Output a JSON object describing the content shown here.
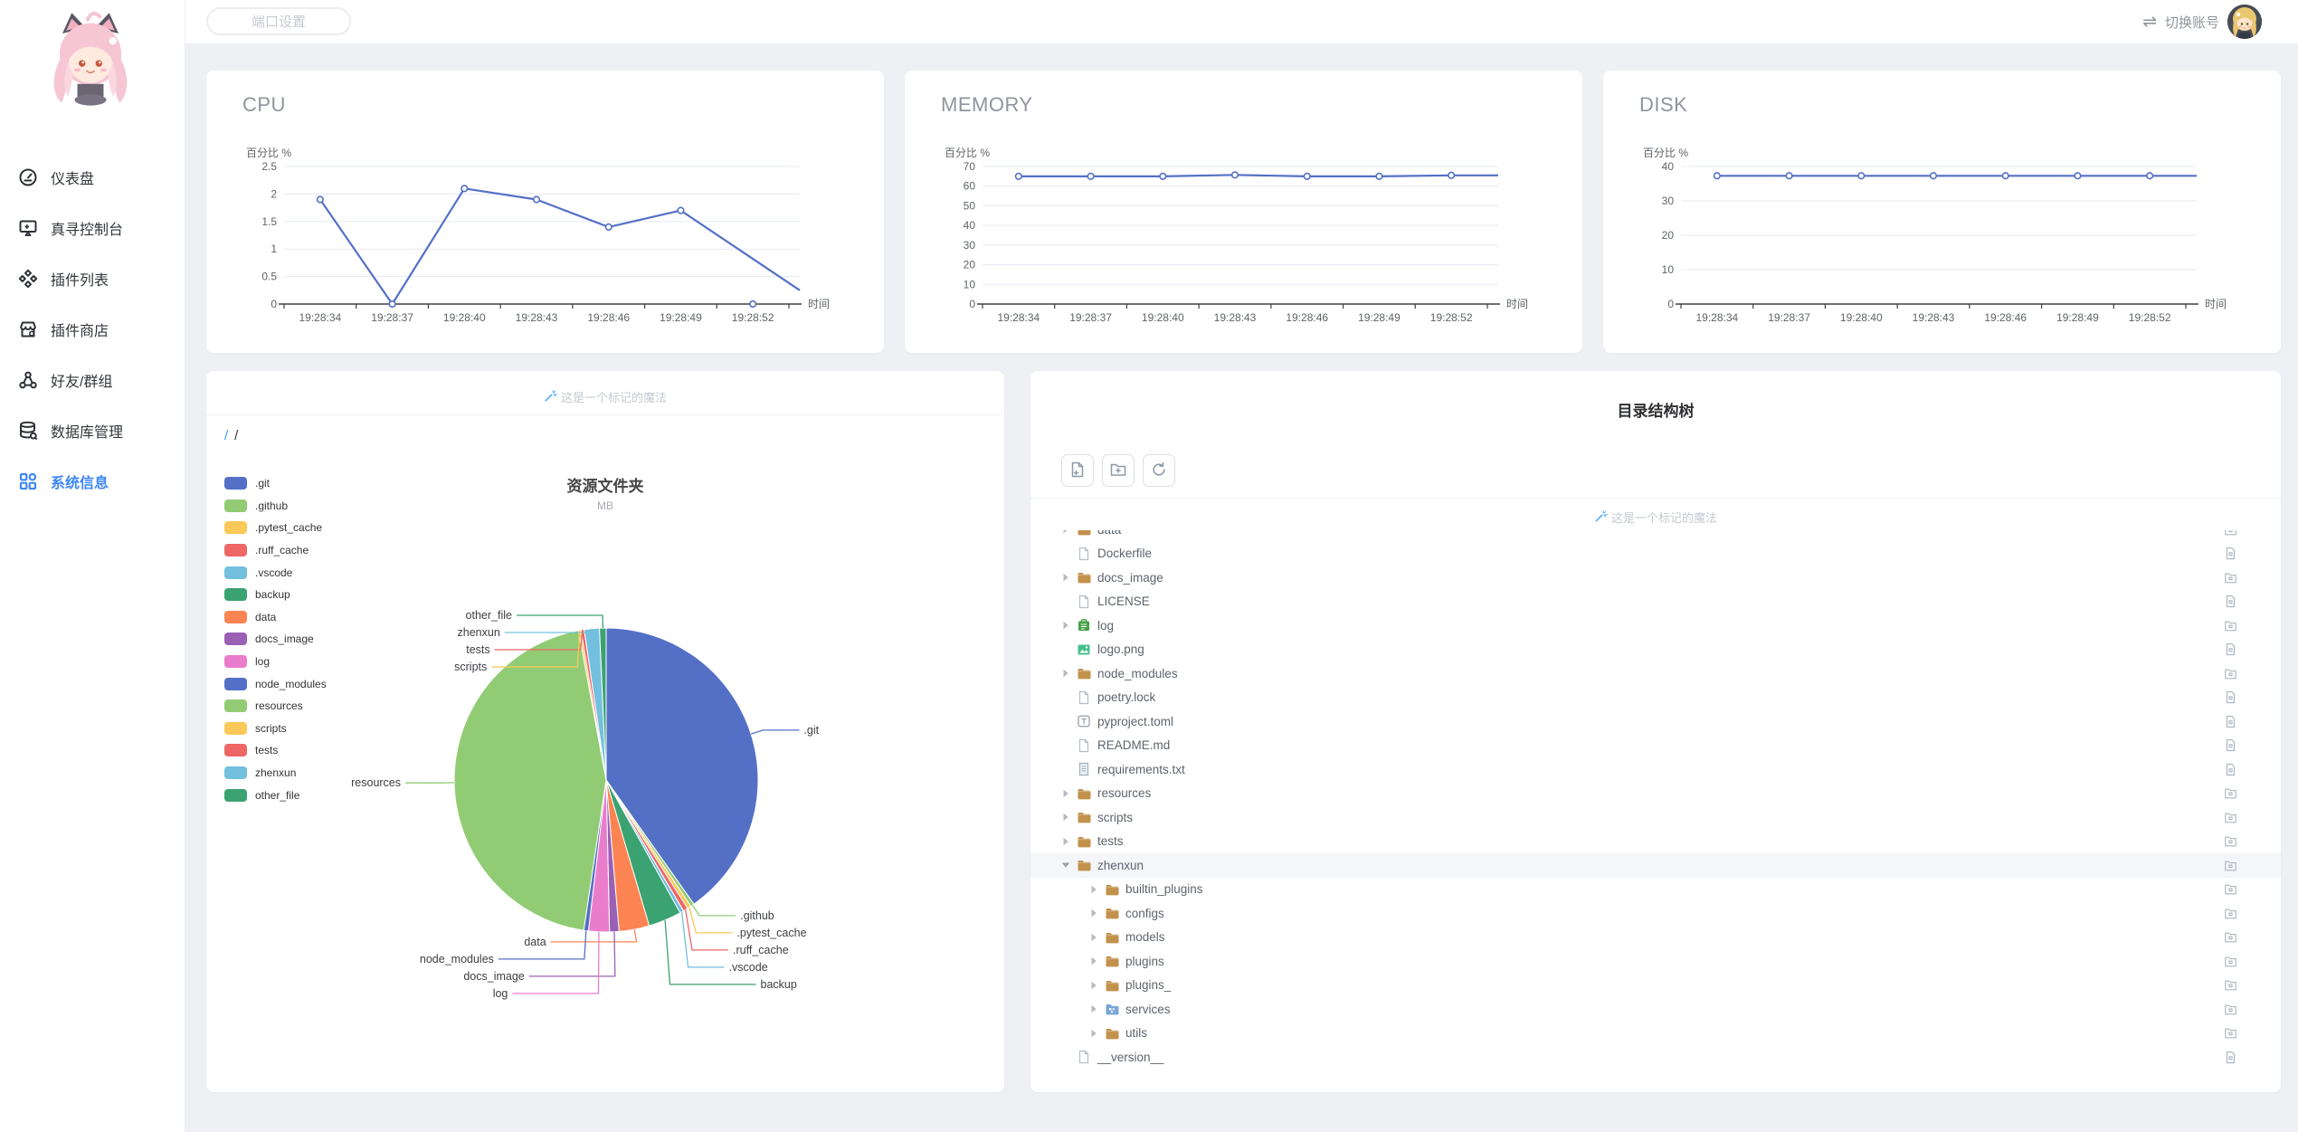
{
  "topbar": {
    "port_settings": "端口设置",
    "switch_account": "切换账号",
    "swap_glyph": "⇌"
  },
  "sidebar": {
    "items": [
      {
        "id": "dashboard",
        "icon": "gauge-icon",
        "label": "仪表盘",
        "active": false
      },
      {
        "id": "console",
        "icon": "console-icon",
        "label": "真寻控制台",
        "active": false
      },
      {
        "id": "plugin-list",
        "icon": "plugins-icon",
        "label": "插件列表",
        "active": false
      },
      {
        "id": "plugin-store",
        "icon": "store-icon",
        "label": "插件商店",
        "active": false
      },
      {
        "id": "friends-groups",
        "icon": "friends-icon",
        "label": "好友/群组",
        "active": false
      },
      {
        "id": "database",
        "icon": "database-icon",
        "label": "数据库管理",
        "active": false
      },
      {
        "id": "system-info",
        "icon": "grid-icon",
        "label": "系统信息",
        "active": true
      }
    ]
  },
  "colors": {
    "accent": "#3f87f5",
    "line": "#5470c6",
    "grid": "#e6eaf2",
    "axis": "#3e4147"
  },
  "chart_data": [
    {
      "id": "cpu",
      "type": "line",
      "title": "CPU",
      "ylabel": "百分比 %",
      "xlabel": "时间",
      "x": [
        "19:28:34",
        "19:28:37",
        "19:28:40",
        "19:28:43",
        "19:28:46",
        "19:28:49",
        "19:28:52"
      ],
      "values": [
        1.9,
        0,
        2.1,
        1.9,
        1.4,
        1.7
      ],
      "stray_point": {
        "x": "19:28:52",
        "value": 0
      },
      "tail_value": 0.25,
      "ylim": [
        0,
        2.5
      ],
      "yticks": [
        0,
        0.5,
        1,
        1.5,
        2,
        2.5
      ]
    },
    {
      "id": "memory",
      "type": "line",
      "title": "MEMORY",
      "ylabel": "百分比 %",
      "xlabel": "时间",
      "x": [
        "19:28:34",
        "19:28:37",
        "19:28:40",
        "19:28:43",
        "19:28:46",
        "19:28:49",
        "19:28:52"
      ],
      "values": [
        65,
        65,
        65,
        65.7,
        65,
        65,
        65.5
      ],
      "tail_value": 65.5,
      "ylim": [
        0,
        70
      ],
      "yticks": [
        0,
        10,
        20,
        30,
        40,
        50,
        60,
        70
      ]
    },
    {
      "id": "disk",
      "type": "line",
      "title": "DISK",
      "ylabel": "百分比 %",
      "xlabel": "时间",
      "x": [
        "19:28:34",
        "19:28:37",
        "19:28:40",
        "19:28:43",
        "19:28:46",
        "19:28:49",
        "19:28:52"
      ],
      "values": [
        37.3,
        37.3,
        37.3,
        37.3,
        37.3,
        37.3,
        37.3
      ],
      "tail_value": 37.3,
      "ylim": [
        0,
        40
      ],
      "yticks": [
        0,
        10,
        20,
        30,
        40
      ]
    },
    {
      "id": "folders",
      "type": "pie",
      "title": "资源文件夹",
      "subtitle": "MB",
      "legend_position": "left",
      "slices": [
        {
          "name": ".git",
          "value": 40.0,
          "color": "#5470c6"
        },
        {
          "name": ".github",
          "value": 0.4,
          "color": "#91cc75"
        },
        {
          "name": ".pytest_cache",
          "value": 0.4,
          "color": "#fac858"
        },
        {
          "name": ".ruff_cache",
          "value": 0.5,
          "color": "#ee6666"
        },
        {
          "name": ".vscode",
          "value": 0.4,
          "color": "#73c0de"
        },
        {
          "name": "backup",
          "value": 3.5,
          "color": "#3ba272"
        },
        {
          "name": "data",
          "value": 3.2,
          "color": "#fc8452"
        },
        {
          "name": "docs_image",
          "value": 1.0,
          "color": "#9a60b4"
        },
        {
          "name": "log",
          "value": 2.2,
          "color": "#ea7ccc"
        },
        {
          "name": "node_modules",
          "value": 0.5,
          "color": "#5470c6"
        },
        {
          "name": "resources",
          "value": 44.5,
          "color": "#91cc75"
        },
        {
          "name": "scripts",
          "value": 0.25,
          "color": "#fac858"
        },
        {
          "name": "tests",
          "value": 0.35,
          "color": "#ee6666"
        },
        {
          "name": "zhenxun",
          "value": 1.6,
          "color": "#73c0de"
        },
        {
          "name": "other_file",
          "value": 0.7,
          "color": "#3ba272"
        }
      ]
    }
  ],
  "files_card": {
    "magic_hint": "这是一个标记的魔法",
    "breadcrumb": [
      "/",
      "/"
    ]
  },
  "tree_card": {
    "title": "目录结构树",
    "magic_hint": "这是一个标记的魔法",
    "toolbar": [
      {
        "id": "new-file-button",
        "icon": "new-file-icon"
      },
      {
        "id": "new-folder-button",
        "icon": "new-folder-icon"
      },
      {
        "id": "refresh-button",
        "icon": "refresh-icon"
      }
    ],
    "rows": [
      {
        "name": "data",
        "icon": "folder",
        "depth": 0,
        "arrow": "right"
      },
      {
        "name": "Dockerfile",
        "icon": "file",
        "depth": 0
      },
      {
        "name": "docs_image",
        "icon": "folder",
        "depth": 0,
        "arrow": "right"
      },
      {
        "name": "LICENSE",
        "icon": "file",
        "depth": 0
      },
      {
        "name": "log",
        "icon": "log",
        "depth": 0,
        "arrow": "right"
      },
      {
        "name": "logo.png",
        "icon": "image",
        "depth": 0
      },
      {
        "name": "node_modules",
        "icon": "folder",
        "depth": 0,
        "arrow": "right"
      },
      {
        "name": "poetry.lock",
        "icon": "file",
        "depth": 0
      },
      {
        "name": "pyproject.toml",
        "icon": "toml",
        "depth": 0
      },
      {
        "name": "README.md",
        "icon": "file",
        "depth": 0
      },
      {
        "name": "requirements.txt",
        "icon": "txt",
        "depth": 0
      },
      {
        "name": "resources",
        "icon": "folder",
        "depth": 0,
        "arrow": "right"
      },
      {
        "name": "scripts",
        "icon": "folder",
        "depth": 0,
        "arrow": "right"
      },
      {
        "name": "tests",
        "icon": "folder",
        "depth": 0,
        "arrow": "right"
      },
      {
        "name": "zhenxun",
        "icon": "folder",
        "depth": 0,
        "arrow": "down",
        "selected": true
      },
      {
        "name": "builtin_plugins",
        "icon": "folder",
        "depth": 1,
        "arrow": "right"
      },
      {
        "name": "configs",
        "icon": "folder",
        "depth": 1,
        "arrow": "right"
      },
      {
        "name": "models",
        "icon": "folder",
        "depth": 1,
        "arrow": "right"
      },
      {
        "name": "plugins",
        "icon": "folder",
        "depth": 1,
        "arrow": "right"
      },
      {
        "name": "plugins_",
        "icon": "folder",
        "depth": 1,
        "arrow": "right"
      },
      {
        "name": "services",
        "icon": "services",
        "depth": 1,
        "arrow": "right"
      },
      {
        "name": "utils",
        "icon": "folder",
        "depth": 1,
        "arrow": "right"
      },
      {
        "name": "__version__",
        "icon": "file",
        "depth": 0
      }
    ]
  }
}
